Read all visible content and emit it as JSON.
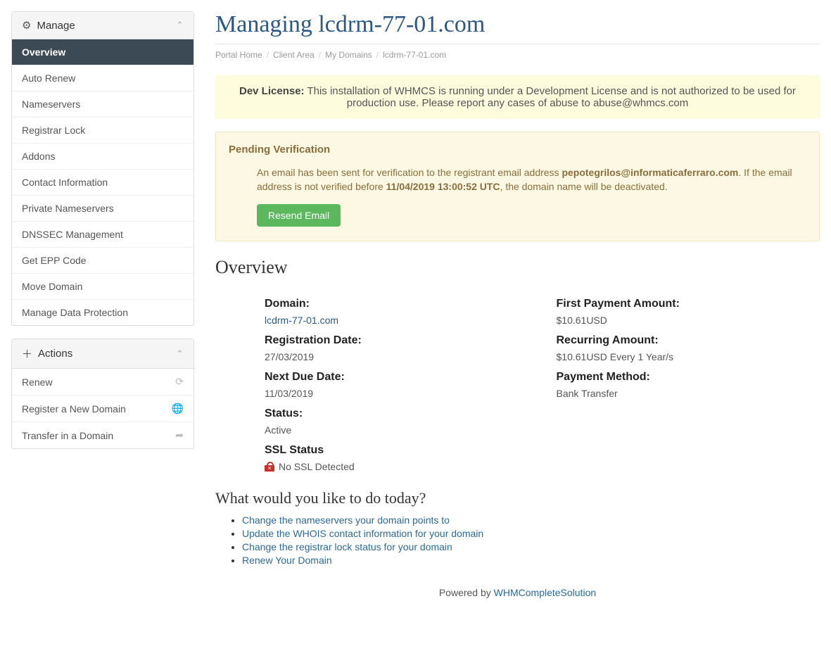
{
  "sidebar": {
    "manage_heading": "Manage",
    "manage_items": [
      "Overview",
      "Auto Renew",
      "Nameservers",
      "Registrar Lock",
      "Addons",
      "Contact Information",
      "Private Nameservers",
      "DNSSEC Management",
      "Get EPP Code",
      "Move Domain",
      "Manage Data Protection"
    ],
    "actions_heading": "Actions",
    "action_items": [
      "Renew",
      "Register a New Domain",
      "Transfer in a Domain"
    ]
  },
  "header": {
    "title": "Managing lcdrm-77-01.com",
    "breadcrumbs": [
      "Portal Home",
      "Client Area",
      "My Domains",
      "lcdrm-77-01.com"
    ]
  },
  "dev_banner": {
    "label": "Dev License:",
    "text": "This installation of WHMCS is running under a Development License and is not authorized to be used for production use. Please report any cases of abuse to abuse@whmcs.com"
  },
  "pending": {
    "title": "Pending Verification",
    "prefix": "An email has been sent for verification to the registrant email address ",
    "email": "pepotegrilos@informaticaferraro.com",
    "mid": ". If the email address is not verified before ",
    "deadline": "11/04/2019 13:00:52 UTC",
    "suffix": ", the domain name will be deactivated.",
    "button": "Resend Email"
  },
  "overview": {
    "heading": "Overview",
    "left": {
      "domain_label": "Domain:",
      "domain_value": "lcdrm-77-01.com",
      "reg_date_label": "Registration Date:",
      "reg_date_value": "27/03/2019",
      "due_label": "Next Due Date:",
      "due_value": "11/03/2019",
      "status_label": "Status:",
      "status_value": "Active",
      "ssl_label": "SSL Status",
      "ssl_value": "No SSL Detected"
    },
    "right": {
      "first_pay_label": "First Payment Amount:",
      "first_pay_value": "$10.61USD",
      "recurring_label": "Recurring Amount:",
      "recurring_value": "$10.61USD Every 1 Year/s",
      "method_label": "Payment Method:",
      "method_value": "Bank Transfer"
    }
  },
  "todo": {
    "heading": "What would you like to do today?",
    "items": [
      "Change the nameservers your domain points to",
      "Update the WHOIS contact information for your domain",
      "Change the registrar lock status for your domain",
      "Renew Your Domain"
    ]
  },
  "footer": {
    "prefix": "Powered by ",
    "link": "WHMCompleteSolution"
  }
}
